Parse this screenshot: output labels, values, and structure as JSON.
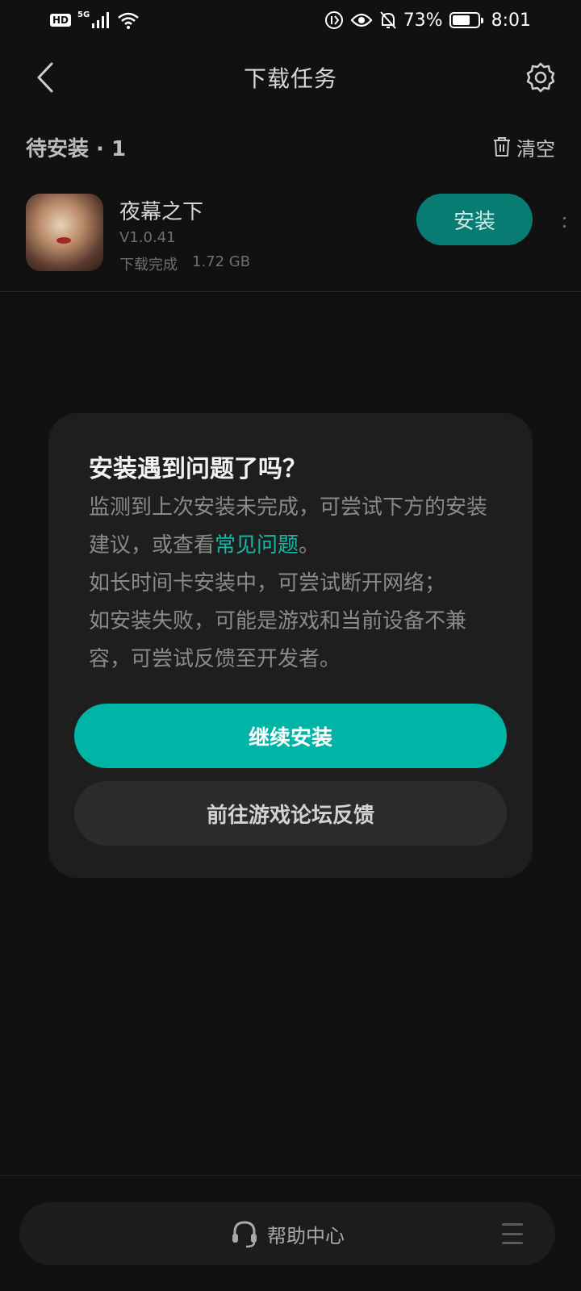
{
  "status_bar": {
    "hd": "HD",
    "network": "5G",
    "battery": "73%",
    "battery_level": 0.73,
    "time": "8:01"
  },
  "header": {
    "title": "下载任务",
    "back_icon": "chevron-left-icon",
    "settings_icon": "gear-icon"
  },
  "section": {
    "title": "待安装 · 1",
    "clear_label": "清空",
    "clear_icon": "trash-icon"
  },
  "task": {
    "app_name": "夜幕之下",
    "version": "V1.0.41",
    "status": "下载完成",
    "size": "1.72 GB",
    "install_label": "安装"
  },
  "dialog": {
    "title": "安装遇到问题了吗？",
    "body_part1": "监测到上次安装未完成，可尝试下方的安装建议，或查看",
    "faq_link": "常见问题",
    "body_part2": "。",
    "line2": "如长时间卡安装中，可尝试断开网络；",
    "line3": "如安装失败，可能是游戏和当前设备不兼容，可尝试反馈至开发者。",
    "continue_label": "继续安装",
    "forum_label": "前往游戏论坛反馈"
  },
  "bottom": {
    "help_label": "帮助中心",
    "help_icon": "headset-icon",
    "menu_icon": "menu-icon"
  },
  "colors": {
    "accent": "#00b5a5",
    "install_button": "#087c72",
    "background": "#111111",
    "dialog_bg": "#1e1e1e"
  }
}
